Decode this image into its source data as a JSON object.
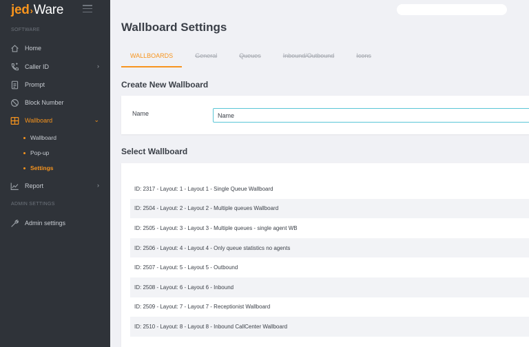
{
  "sidebar": {
    "brand": {
      "prefix": "jed",
      "arrow": "›",
      "suffix": "Ware"
    },
    "section_software": "SOFTWARE",
    "section_admin": "ADMIN SETTINGS",
    "items": [
      {
        "label": "Home",
        "icon": "home-icon"
      },
      {
        "label": "Caller ID",
        "icon": "caller-id-icon"
      },
      {
        "label": "Prompt",
        "icon": "prompt-icon"
      },
      {
        "label": "Block Number",
        "icon": "block-icon"
      },
      {
        "label": "Wallboard",
        "icon": "wallboard-icon"
      },
      {
        "label": "Report",
        "icon": "report-icon"
      },
      {
        "label": "Admin settings",
        "icon": "wrench-icon"
      }
    ],
    "sub_items": [
      {
        "label": "Wallboard"
      },
      {
        "label": "Pop-up"
      },
      {
        "label": "Settings"
      }
    ],
    "accent_color": "#f7941d"
  },
  "main": {
    "title": "Wallboard Settings",
    "tabs": [
      {
        "label": "WALLBOARDS"
      },
      {
        "label": "General"
      },
      {
        "label": "Queues"
      },
      {
        "label": "Inbound/Outbound"
      },
      {
        "label": "Icons"
      }
    ],
    "create_heading": "Create New Wallboard",
    "name_label": "Name",
    "name_value": "Name",
    "select_heading": "Select Wallboard",
    "wallboards": [
      "ID: 2317 - Layout: 1 - Layout 1 - Single Queue Wallboard",
      "ID: 2504 - Layout: 2 - Layout 2 - Multiple queues Wallboard",
      "ID: 2505 - Layout: 3 - Layout 3 - Multiple queues - single agent WB",
      "ID: 2506 - Layout: 4 - Layout 4 - Only queue statistics no agents",
      "ID: 2507 - Layout: 5 - Layout 5 - Outbound",
      "ID: 2508 - Layout: 6 - Layout 6 - Inbound",
      "ID: 2509 - Layout: 7 - Layout 7 - Receptionist Wallboard",
      "ID: 2510 - Layout: 8 - Layout 8 - Inbound CallCenter Wallboard"
    ]
  }
}
